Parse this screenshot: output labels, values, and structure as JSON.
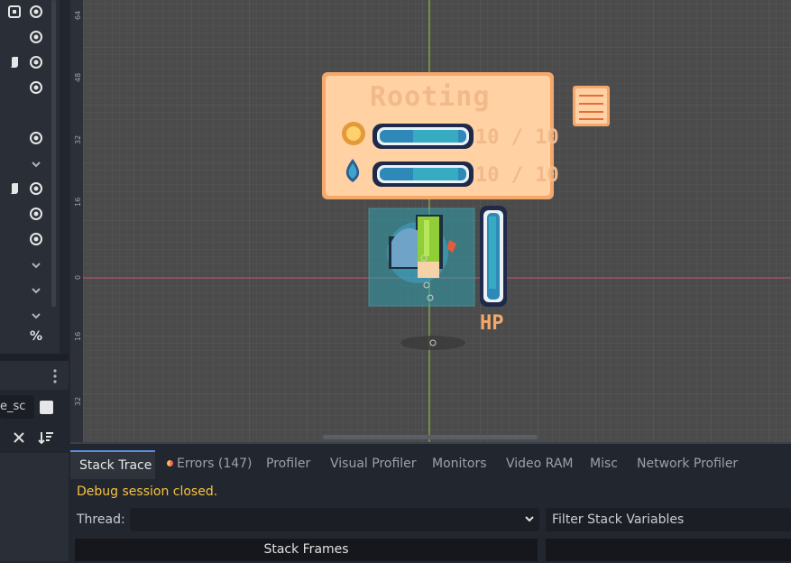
{
  "scene_tree": {
    "visibility_icons": [
      "eye-icon",
      "eye-icon",
      "eye-icon",
      "eye-icon",
      "eye-icon",
      "chevron-down-icon",
      "eye-icon",
      "eye-icon",
      "eye-icon",
      "chevron-down-icon",
      "chevron-down-icon",
      "chevron-down-icon"
    ],
    "percent_label": "%"
  },
  "filesystem": {
    "search_value": "e_sc"
  },
  "viewport": {
    "ruler_marks": [
      "64",
      "48",
      "32",
      "16",
      "0",
      "16",
      "32"
    ],
    "hud": {
      "title": "Rooting",
      "bar1_text": "10 / 10",
      "bar2_text": "10 / 10",
      "bar1_fill": 1.0,
      "bar2_fill": 1.0
    },
    "hp_label": "HP",
    "hp_fill": 1.0
  },
  "debugger": {
    "tabs": [
      "Stack Trace",
      "Errors (147)",
      "Profiler",
      "Visual Profiler",
      "Monitors",
      "Video RAM",
      "Misc",
      "Network Profiler"
    ],
    "status": "Debug session closed.",
    "thread_label": "Thread:",
    "thread_value": "",
    "filter_placeholder": "Filter Stack Variables",
    "frames_header": "Stack Frames"
  },
  "colors": {
    "accent": "#5b8fdd",
    "warning": "#f7c243",
    "hud_bg": "#ffd1a3",
    "hud_border": "#f4a86b"
  }
}
